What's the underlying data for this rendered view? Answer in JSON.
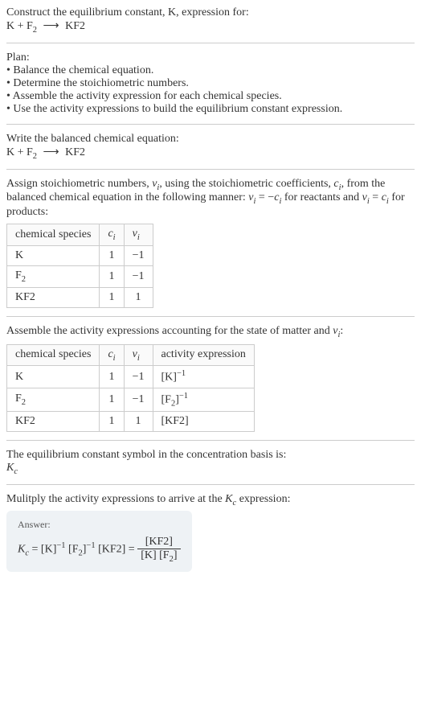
{
  "intro": {
    "line1": "Construct the equilibrium constant, K, expression for:",
    "eq_lhs_a": "K + F",
    "eq_lhs_sub": "2",
    "arrow": "⟶",
    "eq_rhs": "KF2"
  },
  "plan": {
    "title": "Plan:",
    "items": [
      "• Balance the chemical equation.",
      "• Determine the stoichiometric numbers.",
      "• Assemble the activity expression for each chemical species.",
      "• Use the activity expressions to build the equilibrium constant expression."
    ]
  },
  "balanced": {
    "title": "Write the balanced chemical equation:",
    "eq_lhs_a": "K + F",
    "eq_lhs_sub": "2",
    "arrow": "⟶",
    "eq_rhs": "KF2"
  },
  "stoich": {
    "intro_a": "Assign stoichiometric numbers, ",
    "nu": "ν",
    "sub_i": "i",
    "intro_b": ", using the stoichiometric coefficients, ",
    "c": "c",
    "intro_c": ", from the balanced chemical equation in the following manner: ",
    "rel1_a": "ν",
    "rel1_b": " = −",
    "rel1_c": "c",
    "intro_d": " for reactants and ",
    "rel2_a": "ν",
    "rel2_b": " = ",
    "rel2_c": "c",
    "intro_e": " for products:",
    "headers": {
      "species": "chemical species",
      "c": "c",
      "nu": "ν",
      "sub": "i"
    },
    "rows": [
      {
        "species": "K",
        "c": "1",
        "nu": "−1"
      },
      {
        "species_a": "F",
        "species_sub": "2",
        "c": "1",
        "nu": "−1"
      },
      {
        "species": "KF2",
        "c": "1",
        "nu": "1"
      }
    ]
  },
  "activity": {
    "intro_a": "Assemble the activity expressions accounting for the state of matter and ",
    "nu": "ν",
    "sub_i": "i",
    "intro_b": ":",
    "headers": {
      "species": "chemical species",
      "c": "c",
      "nu": "ν",
      "sub": "i",
      "expr": "activity expression"
    },
    "rows": [
      {
        "species": "K",
        "c": "1",
        "nu": "−1",
        "expr_base": "[K]",
        "expr_sup": "−1"
      },
      {
        "species_a": "F",
        "species_sub": "2",
        "c": "1",
        "nu": "−1",
        "expr_base_a": "[F",
        "expr_base_sub": "2",
        "expr_base_b": "]",
        "expr_sup": "−1"
      },
      {
        "species": "KF2",
        "c": "1",
        "nu": "1",
        "expr_base": "[KF2]"
      }
    ]
  },
  "symbol": {
    "title": "The equilibrium constant symbol in the concentration basis is:",
    "K": "K",
    "sub": "c"
  },
  "final": {
    "intro_a": "Mulitply the activity expressions to arrive at the ",
    "K": "K",
    "sub": "c",
    "intro_b": " expression:",
    "answer_label": "Answer:",
    "lhs_K": "K",
    "lhs_sub": "c",
    "eq": " = ",
    "t1_base": "[K]",
    "t1_sup": "−1",
    "t2_a": " [F",
    "t2_sub": "2",
    "t2_b": "]",
    "t2_sup": "−1",
    "t3": " [KF2] = ",
    "frac_num": "[KF2]",
    "frac_den_a": "[K] [F",
    "frac_den_sub": "2",
    "frac_den_b": "]"
  }
}
